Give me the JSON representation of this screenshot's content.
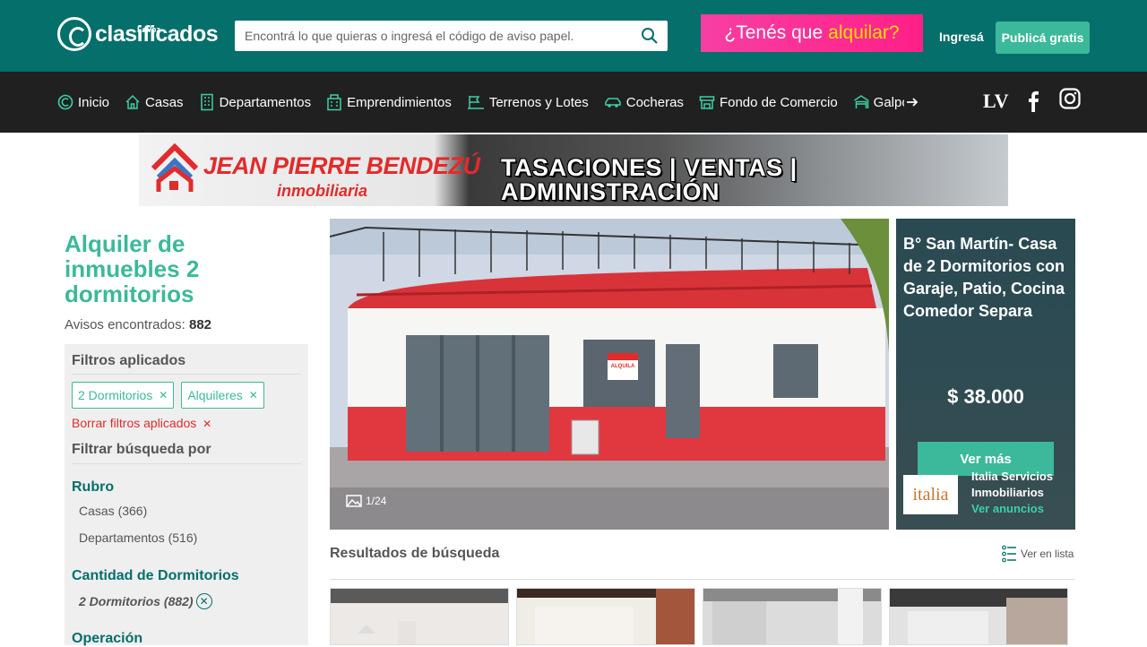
{
  "header": {
    "logo_text": "clasificados",
    "logo_sub": "LaVoz",
    "search_placeholder": "Encontrá lo que quieras o ingresá el código de aviso papel.",
    "promo_text": "¿Tenés que",
    "promo_accent": "alquilar?",
    "login_label": "Ingresá",
    "publish_label": "Publicá gratis"
  },
  "nav": {
    "items": [
      {
        "label": "Inicio",
        "icon": "home-logo-icon"
      },
      {
        "label": "Casas",
        "icon": "house-icon"
      },
      {
        "label": "Departamentos",
        "icon": "building-icon"
      },
      {
        "label": "Emprendimientos",
        "icon": "development-icon"
      },
      {
        "label": "Terrenos y Lotes",
        "icon": "land-icon"
      },
      {
        "label": "Cocheras",
        "icon": "car-icon"
      },
      {
        "label": "Fondo de Comercio",
        "icon": "store-icon"
      },
      {
        "label": "Galpones y Depósitos",
        "icon": "warehouse-icon"
      }
    ],
    "lv_label": "LV"
  },
  "banner": {
    "brand_line1": "JEAN PIERRE BENDEZÚ",
    "brand_line2": "inmobiliaria",
    "slogan": "TASACIONES | VENTAS | ADMINISTRACIÓN"
  },
  "sidebar": {
    "title": "Alquiler de inmuebles 2 dormitorios",
    "count_label": "Avisos encontrados:",
    "count_value": "882",
    "applied_heading": "Filtros aplicados",
    "chips": [
      {
        "label": "2 Dormitorios"
      },
      {
        "label": "Alquileres"
      }
    ],
    "clear_label": "Borrar filtros aplicados",
    "filter_heading": "Filtrar búsqueda por",
    "groups": {
      "rubro": "Rubro",
      "dormitorios": "Cantidad de Dormitorios",
      "operacion": "Operación"
    },
    "rubro_options": [
      {
        "label": "Casas (366)"
      },
      {
        "label": "Departamentos (516)"
      }
    ],
    "dormitorios_selected": "2 Dormitorios (882)"
  },
  "featured": {
    "photo_counter": "1/24",
    "title": "B° San Martín- Casa de 2 Dormitorios con Garaje, Patio, Cocina Comedor Separa",
    "price": "$ 38.000",
    "cta": "Ver más",
    "agency_logo_text": "italia",
    "agency_name": "Italia Servicios Inmobiliarios",
    "agency_link": "Ver anuncios",
    "sign_text": "ALQUILA"
  },
  "results": {
    "title": "Resultados de búsqueda",
    "view_toggle": "Ver en lista"
  },
  "colors": {
    "brand_teal": "#046f6b",
    "accent_green": "#3cb99a",
    "promo_pink": "#ff2d95",
    "nav_dark": "#202020",
    "danger_red": "#e22b2b"
  }
}
